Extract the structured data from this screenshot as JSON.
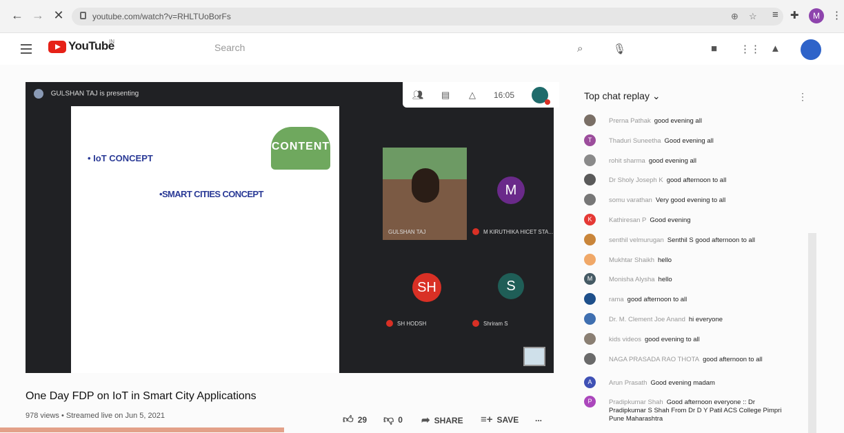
{
  "browser": {
    "url": "youtube.com/watch?v=RHLTUoBorFs",
    "back_icon": "arrow-left-icon",
    "forward_icon": "arrow-right-icon",
    "close_icon": "close-icon",
    "profile_initial": "M"
  },
  "header": {
    "logo_text": "YouTube",
    "country_code": "IN",
    "search_placeholder": "Search"
  },
  "video": {
    "presenter_text": "GULSHAN TAJ is presenting",
    "time": "16:05",
    "slide": {
      "badge_text": "CONTENT",
      "bullet1": "•  IoT CONCEPT",
      "bullet2": "•SMART CITIES CONCEPT"
    },
    "tiles": [
      {
        "label": "GULSHAN TAJ"
      },
      {
        "label": "M KIRUTHIKA HICET STA...",
        "initial": "M",
        "color": "#6a2a8a"
      },
      {
        "label": "SH HODSH",
        "initial": "SH",
        "color": "#d93025"
      },
      {
        "label": "Shriram S",
        "initial": "S",
        "color": "#1f5e57"
      }
    ]
  },
  "info": {
    "title": "One Day FDP on IoT in Smart City Applications",
    "meta": "978 views • Streamed live on Jun 5, 2021",
    "likes": "29",
    "dislikes": "0",
    "share_label": "SHARE",
    "save_label": "SAVE",
    "more_label": "..."
  },
  "chat": {
    "title": "Top chat replay",
    "messages": [
      {
        "author": "Prerna Pathak",
        "text": "good evening all",
        "color": "#7a6f66",
        "initial": ""
      },
      {
        "author": "Thaduri Suneetha",
        "text": "Good evening all",
        "color": "#9c4d9c",
        "initial": "T"
      },
      {
        "author": "rohit sharma",
        "text": "good evening all",
        "color": "#8a8a8a",
        "initial": ""
      },
      {
        "author": "Dr Sholy Joseph K",
        "text": "good afternoon to all",
        "color": "#5a5a5a",
        "initial": ""
      },
      {
        "author": "somu varathan",
        "text": "Very good evening to all",
        "color": "#777777",
        "initial": ""
      },
      {
        "author": "Kathiresan P",
        "text": "Good evening",
        "color": "#e53935",
        "initial": "K"
      },
      {
        "author": "senthil velmurugan",
        "text": "Senthil S good afternoon to all",
        "color": "#c9853a",
        "initial": ""
      },
      {
        "author": "Mukhtar Shaikh",
        "text": "hello",
        "color": "#f0a868",
        "initial": ""
      },
      {
        "author": "Monisha Alysha",
        "text": "hello",
        "color": "#455a64",
        "initial": "M"
      },
      {
        "author": "rama",
        "text": "good afternoon to all",
        "color": "#1e4f8a",
        "initial": ""
      },
      {
        "author": "Dr. M. Clement Joe Anand",
        "text": "hi everyone",
        "color": "#3f6fb0",
        "initial": ""
      },
      {
        "author": "kids videos",
        "text": "good evening to all",
        "color": "#8a7f73",
        "initial": ""
      },
      {
        "author": "NAGA PRASADA RAO THOTA",
        "text": "good afternoon to all",
        "color": "#6a6a6a",
        "initial": ""
      },
      {
        "author": "Arun Prasath",
        "text": "Good evening madam",
        "color": "#3f51b5",
        "initial": "A"
      },
      {
        "author": "Pradipkumar Shah",
        "text": "Good afternoon everyone :: Dr Pradipkumar S Shah From Dr D Y Patil ACS College Pimpri Pune Maharashtra",
        "color": "#ab47bc",
        "initial": "P"
      }
    ]
  }
}
